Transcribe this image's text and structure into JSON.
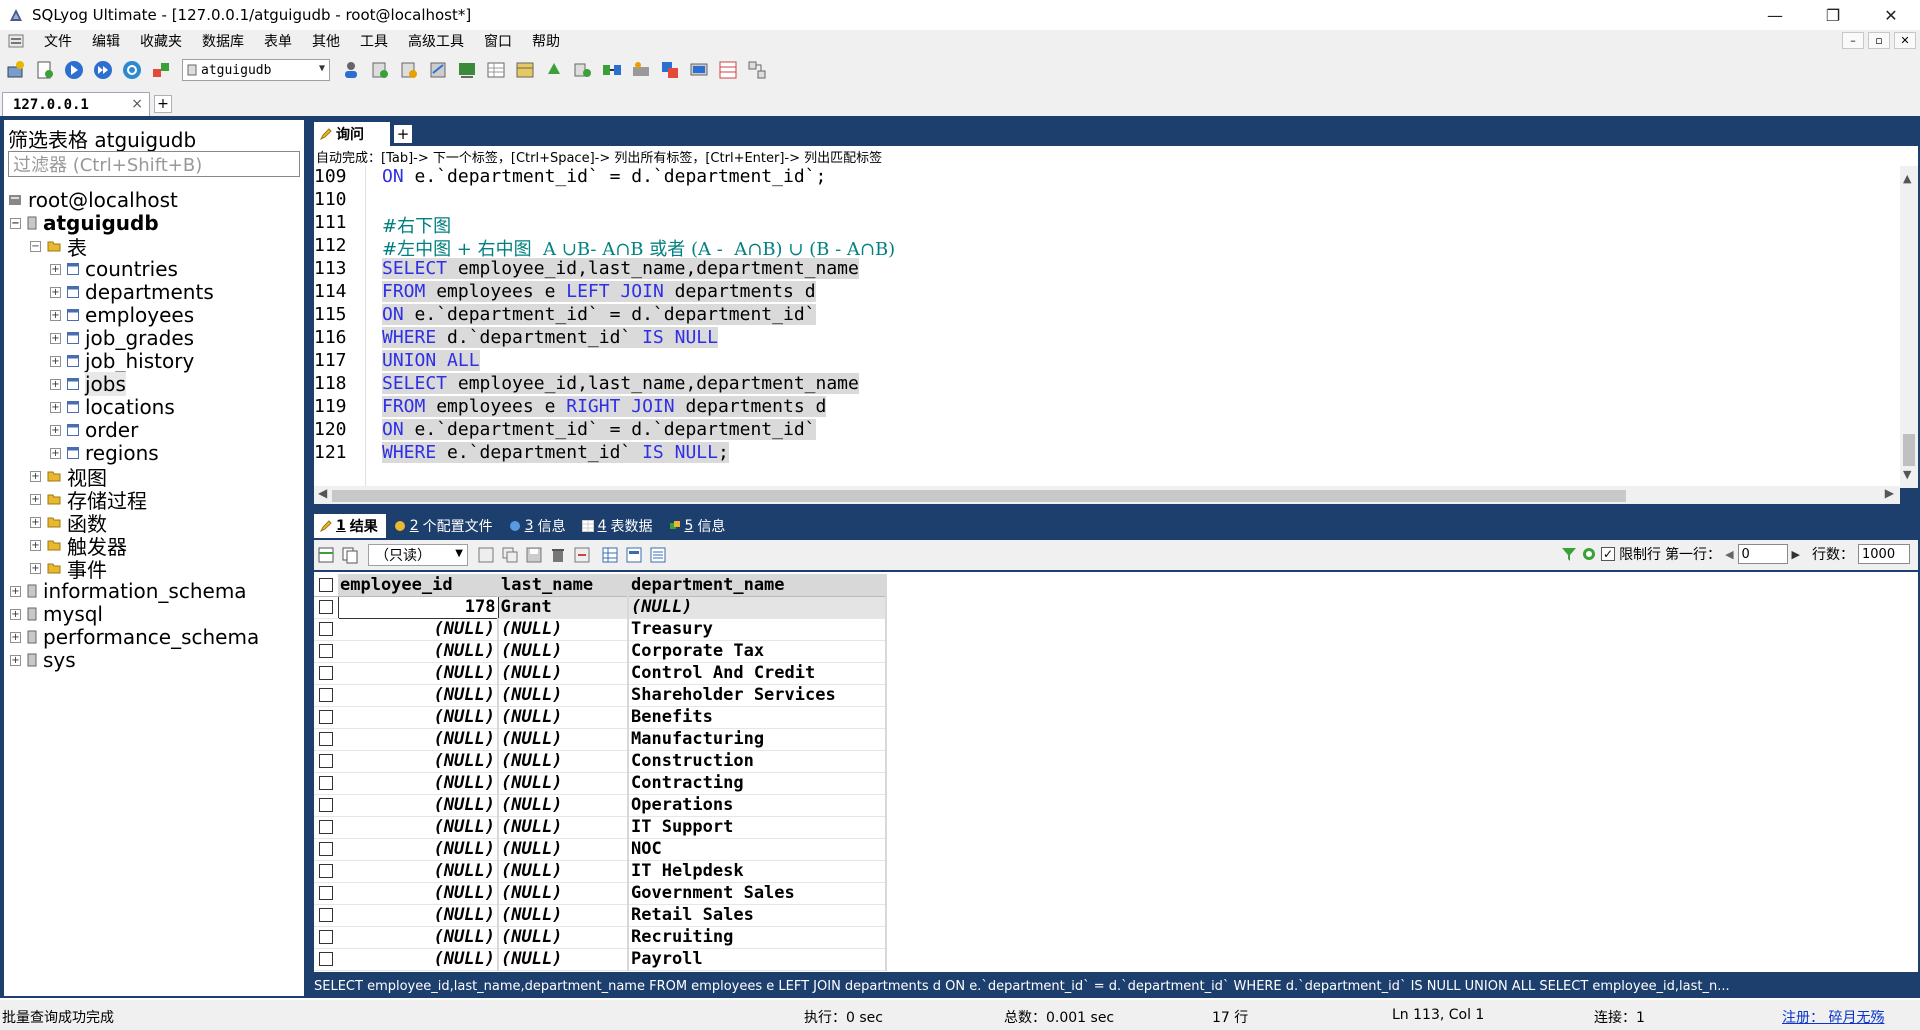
{
  "window": {
    "title": "SQLyog Ultimate - [127.0.0.1/atguigudb - root@localhost*]",
    "controls": {
      "minimize": "—",
      "restore": "❐",
      "close": "✕"
    }
  },
  "menu": {
    "items": [
      "文件",
      "编辑",
      "收藏夹",
      "数据库",
      "表单",
      "其他",
      "工具",
      "高级工具",
      "窗口",
      "帮助"
    ],
    "mdi": {
      "minimize": "–",
      "restore": "▫",
      "close": "✕"
    }
  },
  "toolbar": {
    "database_select": "atguigudb"
  },
  "connection_tab": {
    "label": "127.0.0.1",
    "close": "×",
    "add": "+"
  },
  "left_panel": {
    "filter_title": "筛选表格 atguigudb",
    "filter_placeholder": "过滤器 (Ctrl+Shift+B)",
    "root": "root@localhost",
    "database": "atguigudb",
    "tables_folder": "表",
    "tables": [
      "countries",
      "departments",
      "employees",
      "job_grades",
      "job_history",
      "jobs",
      "locations",
      "order",
      "regions"
    ],
    "folders": [
      "视图",
      "存储过程",
      "函数",
      "触发器",
      "事件"
    ],
    "other_databases": [
      "information_schema",
      "mysql",
      "performance_schema",
      "sys"
    ]
  },
  "query_tab": {
    "label": "询问",
    "add": "+"
  },
  "autocomplete_hint": "自动完成：[Tab]-> 下一个标签，[Ctrl+Space]-> 列出所有标签，[Ctrl+Enter]-> 列出匹配标签",
  "editor": {
    "lines": [
      {
        "n": "109",
        "code": "ON e.`department_id` = d.`department_id`;"
      },
      {
        "n": "110",
        "code": ""
      },
      {
        "n": "111",
        "code": "#右下图"
      },
      {
        "n": "112",
        "code": "#左中图 + 右中图  A ∪B- A∩B 或者 (A -  A∩B) ∪ (B - A∩B)"
      },
      {
        "n": "113",
        "code": "SELECT employee_id,last_name,department_name"
      },
      {
        "n": "114",
        "code": "FROM employees e LEFT JOIN departments d"
      },
      {
        "n": "115",
        "code": "ON e.`department_id` = d.`department_id`"
      },
      {
        "n": "116",
        "code": "WHERE d.`department_id` IS NULL"
      },
      {
        "n": "117",
        "code": "UNION ALL"
      },
      {
        "n": "118",
        "code": "SELECT employee_id,last_name,department_name"
      },
      {
        "n": "119",
        "code": "FROM employees e RIGHT JOIN departments d"
      },
      {
        "n": "120",
        "code": "ON e.`department_id` = d.`department_id`"
      },
      {
        "n": "121",
        "code": "WHERE e.`department_id` IS NULL;"
      }
    ]
  },
  "result_tabs": [
    {
      "num": "1",
      "label": "结果"
    },
    {
      "num": "2",
      "label": "个配置文件"
    },
    {
      "num": "3",
      "label": "信息"
    },
    {
      "num": "4",
      "label": "表数据"
    },
    {
      "num": "5",
      "label": "信息"
    }
  ],
  "result_toolbar": {
    "mode": "（只读）",
    "limit_label": "限制行",
    "first_row_label": "第一行：",
    "first_row_value": "0",
    "rows_label": "行数：",
    "rows_value": "1000"
  },
  "grid": {
    "columns": [
      "employee_id",
      "last_name",
      "department_name"
    ],
    "rows": [
      [
        "178",
        "Grant",
        "(NULL)"
      ],
      [
        "(NULL)",
        "(NULL)",
        "Treasury"
      ],
      [
        "(NULL)",
        "(NULL)",
        "Corporate Tax"
      ],
      [
        "(NULL)",
        "(NULL)",
        "Control And Credit"
      ],
      [
        "(NULL)",
        "(NULL)",
        "Shareholder Services"
      ],
      [
        "(NULL)",
        "(NULL)",
        "Benefits"
      ],
      [
        "(NULL)",
        "(NULL)",
        "Manufacturing"
      ],
      [
        "(NULL)",
        "(NULL)",
        "Construction"
      ],
      [
        "(NULL)",
        "(NULL)",
        "Contracting"
      ],
      [
        "(NULL)",
        "(NULL)",
        "Operations"
      ],
      [
        "(NULL)",
        "(NULL)",
        "IT Support"
      ],
      [
        "(NULL)",
        "(NULL)",
        "NOC"
      ],
      [
        "(NULL)",
        "(NULL)",
        "IT Helpdesk"
      ],
      [
        "(NULL)",
        "(NULL)",
        "Government Sales"
      ],
      [
        "(NULL)",
        "(NULL)",
        "Retail Sales"
      ],
      [
        "(NULL)",
        "(NULL)",
        "Recruiting"
      ],
      [
        "(NULL)",
        "(NULL)",
        "Payroll"
      ]
    ]
  },
  "sql_strip": "SELECT employee_id,last_name,department_name FROM employees e LEFT JOIN departments d ON e.`department_id` = d.`department_id` WHERE d.`department_id` IS NULL UNION ALL SELECT employee_id,last_n...",
  "status": {
    "message": "批量查询成功完成",
    "exec": "执行：0 sec",
    "total": "总数：0.001 sec",
    "rows": "17 行",
    "position": "Ln 113, Col 1",
    "connections": "连接：1",
    "register": "注册： 碎月无殇"
  },
  "colors": {
    "frame": "#1c3f6e",
    "keyword": "#2f2fe6",
    "comment": "#008080",
    "selection": "#dadada"
  }
}
